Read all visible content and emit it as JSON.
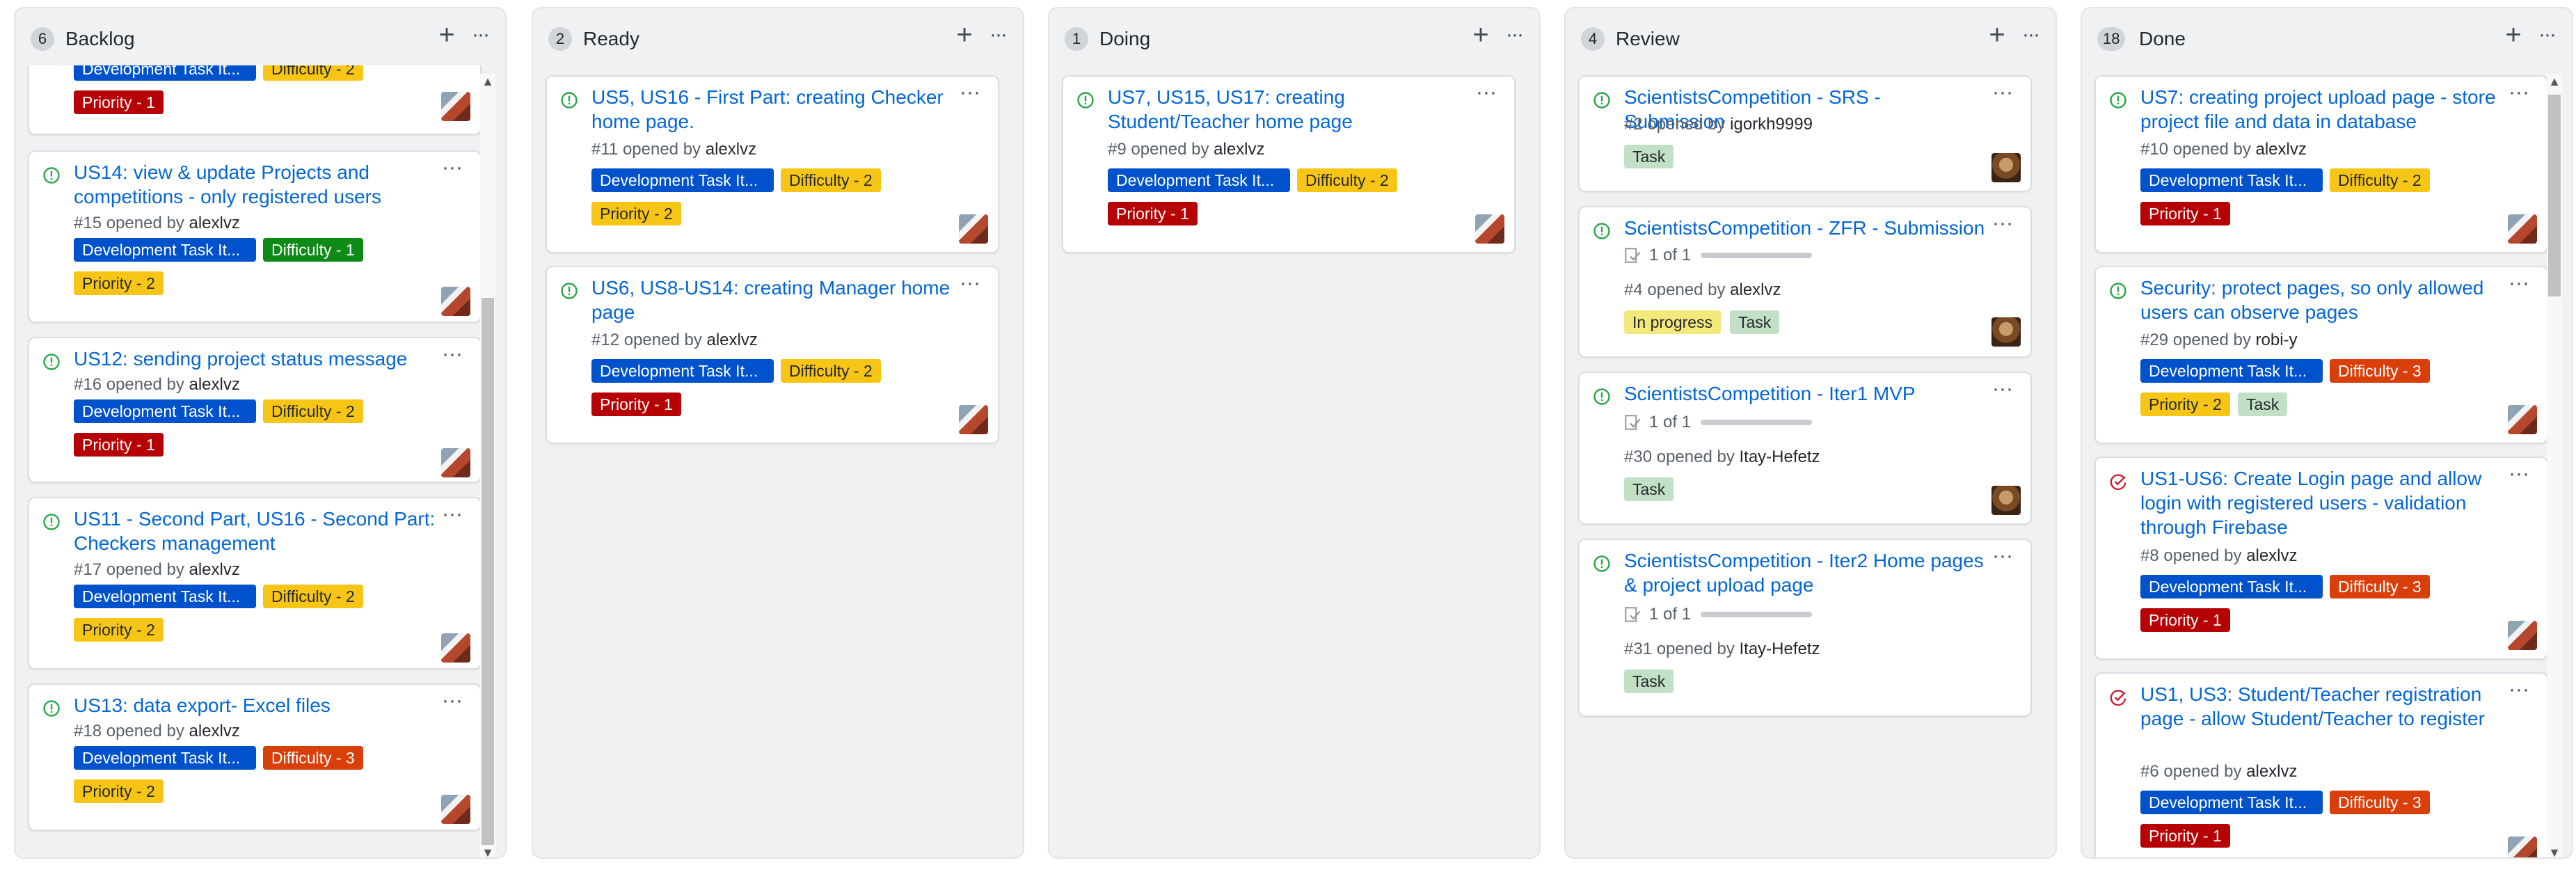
{
  "columns": [
    {
      "title": "Backlog",
      "count": "6",
      "cards": [
        {
          "title": "",
          "labels": [
            {
              "text": "Development Task It...",
              "kind": "dev"
            },
            {
              "text": "Difficulty - 2",
              "kind": "diff2"
            },
            {
              "text": "Priority - 1",
              "kind": "pri1"
            }
          ],
          "avatar": "mixed-avatar",
          "icon": "open-issue-icon"
        },
        {
          "title": "US14: view & update Projects and competitions - only registered users",
          "number": "#15",
          "opened_by_text": "opened by",
          "author": "alexlvz",
          "labels": [
            {
              "text": "Development Task It...",
              "kind": "dev"
            },
            {
              "text": "Difficulty - 1",
              "kind": "diff1"
            },
            {
              "text": "Priority - 2",
              "kind": "pri2"
            }
          ],
          "avatar": "mixed-avatar",
          "icon": "open-issue-icon"
        },
        {
          "title": "US12: sending project status message",
          "number": "#16",
          "opened_by_text": "opened by",
          "author": "alexlvz",
          "labels": [
            {
              "text": "Development Task It...",
              "kind": "dev"
            },
            {
              "text": "Difficulty - 2",
              "kind": "diff2"
            },
            {
              "text": "Priority - 1",
              "kind": "pri1"
            }
          ],
          "avatar": "mixed-avatar",
          "icon": "open-issue-icon"
        },
        {
          "title": "US11 - Second Part, US16 - Second Part: Checkers management",
          "number": "#17",
          "opened_by_text": "opened by",
          "author": "alexlvz",
          "labels": [
            {
              "text": "Development Task It...",
              "kind": "dev"
            },
            {
              "text": "Difficulty - 2",
              "kind": "diff2"
            },
            {
              "text": "Priority - 2",
              "kind": "pri2"
            }
          ],
          "avatar": "mixed-avatar",
          "icon": "open-issue-icon"
        },
        {
          "title": "US13: data export- Excel files",
          "number": "#18",
          "opened_by_text": "opened by",
          "author": "alexlvz",
          "labels": [
            {
              "text": "Development Task It...",
              "kind": "dev"
            },
            {
              "text": "Difficulty - 3",
              "kind": "diff3"
            },
            {
              "text": "Priority - 2",
              "kind": "pri2"
            }
          ],
          "avatar": "mixed-avatar",
          "icon": "open-issue-icon"
        }
      ]
    },
    {
      "title": "Ready",
      "count": "2",
      "cards": [
        {
          "title": "US5, US16 - First Part: creating Checker home page.",
          "number": "#11",
          "opened_by_text": "opened by",
          "author": "alexlvz",
          "labels": [
            {
              "text": "Development Task It...",
              "kind": "dev"
            },
            {
              "text": "Difficulty - 2",
              "kind": "diff2"
            },
            {
              "text": "Priority - 2",
              "kind": "pri2"
            }
          ],
          "avatar": "mixed-avatar",
          "icon": "open-issue-icon"
        },
        {
          "title": "US6, US8-US14: creating Manager home page",
          "number": "#12",
          "opened_by_text": "opened by",
          "author": "alexlvz",
          "labels": [
            {
              "text": "Development Task It...",
              "kind": "dev"
            },
            {
              "text": "Difficulty - 2",
              "kind": "diff2"
            },
            {
              "text": "Priority - 1",
              "kind": "pri1"
            }
          ],
          "avatar": "mixed-avatar",
          "icon": "open-issue-icon"
        }
      ]
    },
    {
      "title": "Doing",
      "count": "1",
      "cards": [
        {
          "title": "US7, US15, US17: creating Student/Teacher home page",
          "number": "#9",
          "opened_by_text": "opened by",
          "author": "alexlvz",
          "labels": [
            {
              "text": "Development Task It...",
              "kind": "dev"
            },
            {
              "text": "Difficulty - 2",
              "kind": "diff2"
            },
            {
              "text": "Priority - 1",
              "kind": "pri1"
            }
          ],
          "avatar": "mixed-avatar",
          "icon": "open-issue-icon"
        }
      ]
    },
    {
      "title": "Review",
      "count": "4",
      "cards": [
        {
          "title": "ScientistsCompetition - SRS - Submission",
          "number": "#2",
          "opened_by_text": "opened by",
          "author": "igorkh9999",
          "labels": [
            {
              "text": "Task",
              "kind": "task"
            }
          ],
          "avatar": "single-avatar",
          "icon": "open-issue-icon"
        },
        {
          "title": "ScientistsCompetition - ZFR - Submission",
          "progress_text": "1 of 1",
          "progress": 1.0,
          "number": "#4",
          "opened_by_text": "opened by",
          "author": "alexlvz",
          "labels": [
            {
              "text": "In progress",
              "kind": "prog"
            },
            {
              "text": "Task",
              "kind": "task"
            }
          ],
          "avatar": "single-avatar",
          "icon": "open-issue-icon"
        },
        {
          "title": "ScientistsCompetition - Iter1 MVP",
          "progress_text": "1 of 1",
          "progress": 1.0,
          "number": "#30",
          "opened_by_text": "opened by",
          "author": "Itay-Hefetz",
          "labels": [
            {
              "text": "Task",
              "kind": "task"
            }
          ],
          "avatar": "single-avatar",
          "icon": "open-issue-icon"
        },
        {
          "title": "ScientistsCompetition - Iter2 Home pages & project upload page",
          "progress_text": "1 of 1",
          "progress": 1.0,
          "number": "#31",
          "opened_by_text": "opened by",
          "author": "Itay-Hefetz",
          "labels": [
            {
              "text": "Task",
              "kind": "task"
            }
          ],
          "avatar": "none",
          "icon": "open-issue-icon"
        }
      ]
    },
    {
      "title": "Done",
      "count": "18",
      "cards": [
        {
          "title": "US7: creating project upload page - store project file and data in database",
          "number": "#10",
          "opened_by_text": "opened by",
          "author": "alexlvz",
          "labels": [
            {
              "text": "Development Task It...",
              "kind": "dev"
            },
            {
              "text": "Difficulty - 2",
              "kind": "diff2"
            },
            {
              "text": "Priority - 1",
              "kind": "pri1"
            }
          ],
          "avatar": "mixed-avatar",
          "icon": "open-issue-icon"
        },
        {
          "title": "Security: protect pages, so only allowed users can observe pages",
          "number": "#29",
          "opened_by_text": "opened by",
          "author": "robi-y",
          "labels": [
            {
              "text": "Development Task It...",
              "kind": "dev"
            },
            {
              "text": "Difficulty - 3",
              "kind": "diff3"
            },
            {
              "text": "Priority - 2",
              "kind": "pri2"
            },
            {
              "text": "Task",
              "kind": "task"
            }
          ],
          "avatar": "mixed-avatar",
          "icon": "open-issue-icon"
        },
        {
          "title": "US1-US6: Create Login page and allow login with registered users - validation through Firebase",
          "number": "#8",
          "opened_by_text": "opened by",
          "author": "alexlvz",
          "labels": [
            {
              "text": "Development Task It...",
              "kind": "dev"
            },
            {
              "text": "Difficulty - 3",
              "kind": "diff3"
            },
            {
              "text": "Priority - 1",
              "kind": "pri1"
            }
          ],
          "avatar": "mixed-avatar",
          "icon": "closed-issue-icon"
        },
        {
          "title": "US1, US3: Student/Teacher registration page - allow Student/Teacher to register",
          "number": "#6",
          "opened_by_text": "opened by",
          "author": "alexlvz",
          "labels": [
            {
              "text": "Development Task It...",
              "kind": "dev"
            },
            {
              "text": "Difficulty - 3",
              "kind": "diff3"
            },
            {
              "text": "Priority - 1",
              "kind": "pri1"
            }
          ],
          "avatar": "mixed-avatar",
          "icon": "closed-issue-icon"
        }
      ]
    }
  ],
  "colors": {
    "open_issue": "#28a745",
    "closed_issue": "#cb2431",
    "link": "#0366d6"
  },
  "icons": {
    "add": "plus-icon",
    "menu": "ellipsis-icon",
    "scroll_up": "chevron-up-icon",
    "scroll_down": "chevron-down-icon"
  }
}
